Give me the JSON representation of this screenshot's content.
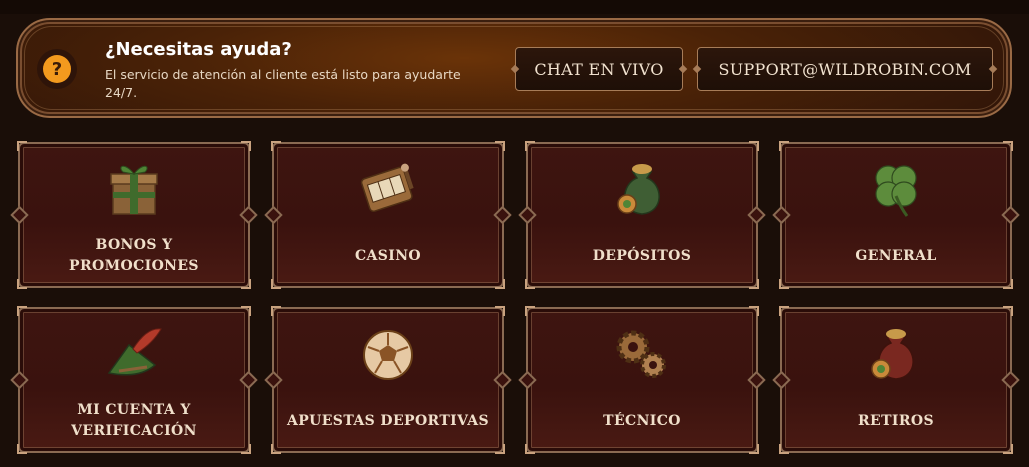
{
  "help": {
    "title": "¿Necesitas ayuda?",
    "description": "El servicio de atención al cliente está listo para ayudarte 24/7.",
    "icon": "question-mark-icon",
    "chat_label": "CHAT EN VIVO",
    "email_label": "SUPPORT@WILDROBIN.COM"
  },
  "categories": [
    {
      "label": "BONOS Y PROMOCIONES",
      "icon": "gift-box-icon"
    },
    {
      "label": "CASINO",
      "icon": "slot-machine-icon"
    },
    {
      "label": "DEPÓSITOS",
      "icon": "money-bag-icon"
    },
    {
      "label": "GENERAL",
      "icon": "clover-icon"
    },
    {
      "label": "MI CUENTA Y VERIFICACIÓN",
      "icon": "feathered-hat-icon"
    },
    {
      "label": "APUESTAS DEPORTIVAS",
      "icon": "soccer-ball-icon"
    },
    {
      "label": "TÉCNICO",
      "icon": "gears-icon"
    },
    {
      "label": "RETIROS",
      "icon": "red-money-bag-icon"
    }
  ],
  "colors": {
    "background": "#1a0e08",
    "accent_orange": "#f39a1e",
    "card_border": "#8a6a52",
    "card_fill": "#3e1510"
  }
}
